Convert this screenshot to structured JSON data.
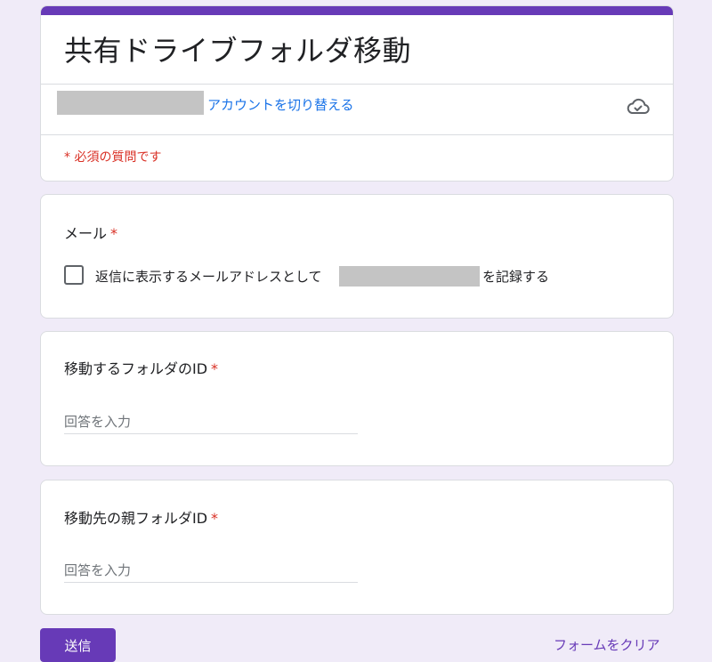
{
  "form": {
    "title": "共有ドライブフォルダ移動",
    "switch_account": "アカウントを切り替える",
    "required_note": "* 必須の質問です",
    "cloud_icon": "cloud-check-icon",
    "accent_color": "#673ab7",
    "required_color": "#d93025"
  },
  "email": {
    "title": "メール",
    "required_mark": "*",
    "checkbox_label_before": "返信に表示するメールアドレスとして",
    "checkbox_label_after": "を記録する"
  },
  "questions": [
    {
      "title": "移動するフォルダのID",
      "required_mark": "*",
      "placeholder": "回答を入力"
    },
    {
      "title": "移動先の親フォルダID",
      "required_mark": "*",
      "placeholder": "回答を入力"
    }
  ],
  "actions": {
    "submit": "送信",
    "clear": "フォームをクリア"
  }
}
